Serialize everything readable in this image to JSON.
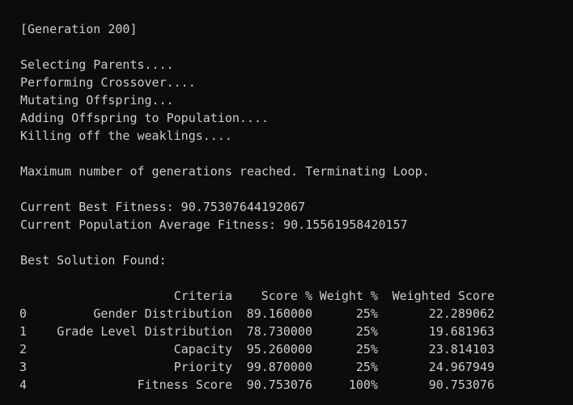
{
  "window": {
    "background": "#0c0c0c",
    "text_color": "#cccccc"
  },
  "log": {
    "generation": "[Generation 200]",
    "steps": [
      "Selecting Parents....",
      "Performing Crossover....",
      "Mutating Offspring...",
      "Adding Offspring to Population....",
      "Killing off the weaklings...."
    ],
    "termination": "Maximum number of generations reached. Terminating Loop.",
    "best_fitness": "Current Best Fitness: 90.75307644192067",
    "avg_fitness": "Current Population Average Fitness: 90.15561958420157",
    "solution_heading": "Best Solution Found:"
  },
  "table": {
    "columns": [
      "Criteria",
      "Score %",
      "Weight %",
      "Weighted Score"
    ],
    "rows": [
      {
        "index": "0",
        "criteria": "Gender Distribution",
        "score": "89.160000",
        "weight": "25%",
        "weighted": "22.289062"
      },
      {
        "index": "1",
        "criteria": "Grade Level Distribution",
        "score": "78.730000",
        "weight": "25%",
        "weighted": "19.681963"
      },
      {
        "index": "2",
        "criteria": "Capacity",
        "score": "95.260000",
        "weight": "25%",
        "weighted": "23.814103"
      },
      {
        "index": "3",
        "criteria": "Priority",
        "score": "99.870000",
        "weight": "25%",
        "weighted": "24.967949"
      },
      {
        "index": "4",
        "criteria": "Fitness Score",
        "score": "90.753076",
        "weight": "100%",
        "weighted": "90.753076"
      }
    ]
  }
}
